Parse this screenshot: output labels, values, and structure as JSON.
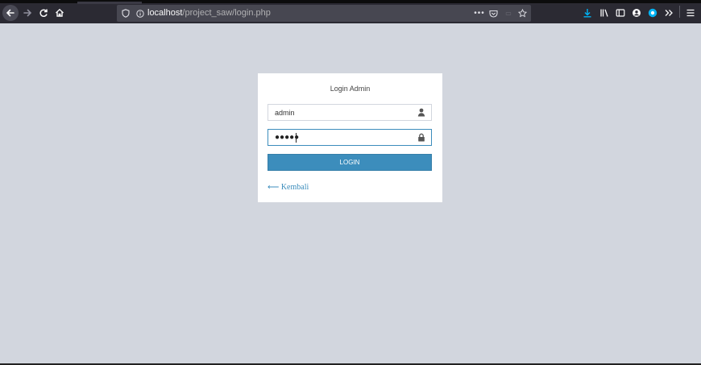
{
  "browser": {
    "url_host": "localhost",
    "url_path": "/project_saw/login.php",
    "icons": {
      "back": "arrow-left-icon",
      "forward": "arrow-right-icon",
      "reload": "reload-icon",
      "home": "home-icon",
      "shield": "tracking-shield-icon",
      "info": "site-info-icon",
      "more": "more-actions-icon",
      "pocket": "pocket-icon",
      "bookmark": "star-icon",
      "download": "download-icon",
      "library": "library-icon",
      "sidebar": "sidebar-icon",
      "account": "account-icon",
      "extension": "extension-icon",
      "overflow": "overflow-chevrons-icon",
      "menu": "hamburger-menu-icon"
    },
    "colors": {
      "toolbar": "#2b2a33",
      "urlbar": "#474751",
      "download_accent": "#00b3f4"
    }
  },
  "login": {
    "title": "Login Admin",
    "username_value": "admin",
    "password_mask": "●●●●●",
    "button_label": "LOGIN",
    "back_link": "⟵ Kembali",
    "colors": {
      "page_bg": "#d2d6de",
      "primary": "#3c8dbc"
    }
  }
}
